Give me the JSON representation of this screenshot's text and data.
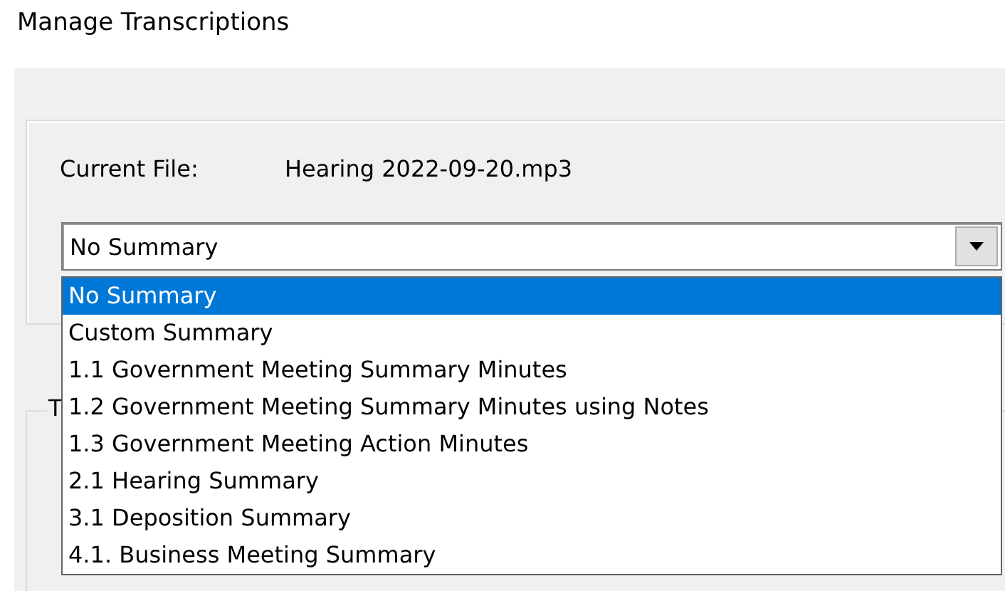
{
  "window": {
    "title": "Manage Transcriptions"
  },
  "current_file": {
    "label": "Current File:",
    "value": "Hearing 2022-09-20.mp3"
  },
  "summary_combo": {
    "value": "No Summary",
    "expanded": true,
    "options": [
      {
        "label": "No Summary",
        "selected": true
      },
      {
        "label": "Custom Summary",
        "selected": false
      },
      {
        "label": "1.1 Government Meeting Summary Minutes",
        "selected": false
      },
      {
        "label": "1.2 Government Meeting Summary Minutes using Notes",
        "selected": false
      },
      {
        "label": "1.3 Government Meeting Action Minutes",
        "selected": false
      },
      {
        "label": "2.1 Hearing Summary",
        "selected": false
      },
      {
        "label": "3.1 Deposition Summary",
        "selected": false
      },
      {
        "label": "4.1. Business Meeting Summary",
        "selected": false
      }
    ]
  },
  "second_group": {
    "legend": "T"
  }
}
